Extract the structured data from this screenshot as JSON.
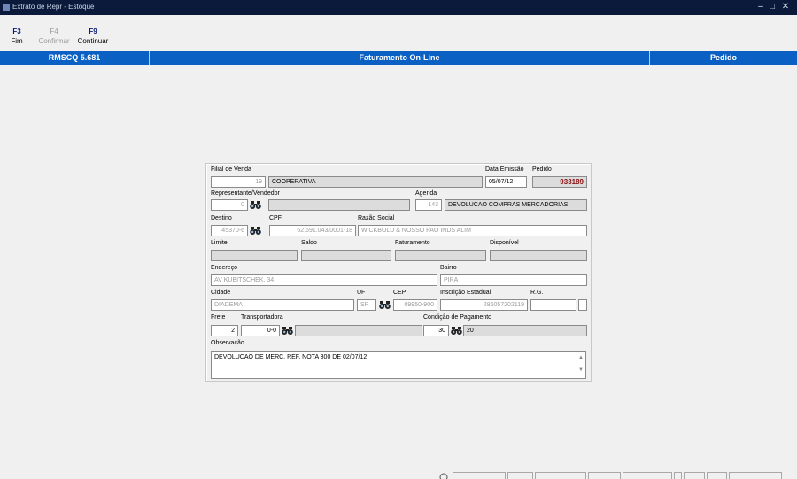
{
  "window": {
    "title": "Extrato de Repr - Estoque"
  },
  "toolbar": {
    "buttons": [
      {
        "key": "F3",
        "label": "Fim"
      },
      {
        "key": "F4",
        "label": "Confirmar"
      },
      {
        "key": "F9",
        "label": "Continuar"
      }
    ]
  },
  "header": {
    "left": "RMSCQ 5.681",
    "center": "Faturamento On-Line",
    "right": "Pedido"
  },
  "form": {
    "filial_label": "Filial de Venda",
    "filial_code": "19",
    "filial_name": "COOPERATIVA",
    "data_emissao_label": "Data Emissão",
    "data_emissao": "05/07/12",
    "pedido_label": "Pedido",
    "pedido": "933189",
    "representante_label": "Representante/Vendedor",
    "representante_code": "0",
    "representante_name": "",
    "agenda_label": "Agenda",
    "agenda_code": "143",
    "agenda_desc": "DEVOLUCAO COMPRAS MERCADORIAS",
    "destino_label": "Destino",
    "destino": "45370-6",
    "cpf_label": "CPF",
    "cpf": "62.691.043/0001-18",
    "razao_label": "Razão Social",
    "razao": "WICKBOLD & NOSSO PAO INDS ALIM",
    "limite_label": "Limite",
    "saldo_label": "Saldo",
    "faturamento_label": "Faturamento",
    "disponivel_label": "Disponível",
    "endereco_label": "Endereço",
    "endereco": "AV KUBITSCHEK, 34",
    "bairro_label": "Bairro",
    "bairro": "PIRA",
    "cidade_label": "Cidade",
    "cidade": "DIADEMA",
    "uf_label": "UF",
    "uf": "SP",
    "cep_label": "CEP",
    "cep": "09950-900",
    "ie_label": "Inscrição Estadual",
    "ie": "286057202119",
    "rg_label": "R.G.",
    "rg": "",
    "frete_label": "Frete",
    "frete": "2",
    "transportadora_label": "Transportadora",
    "transportadora_code": "0-0",
    "condicao_label": "Condição de Pagamento",
    "condicao_code": "30",
    "condicao_desc": "20",
    "observacao_label": "Observação",
    "observacao": "DEVOLUCAO DE MERC. REF. NOTA 300 DE 02/07/12"
  }
}
